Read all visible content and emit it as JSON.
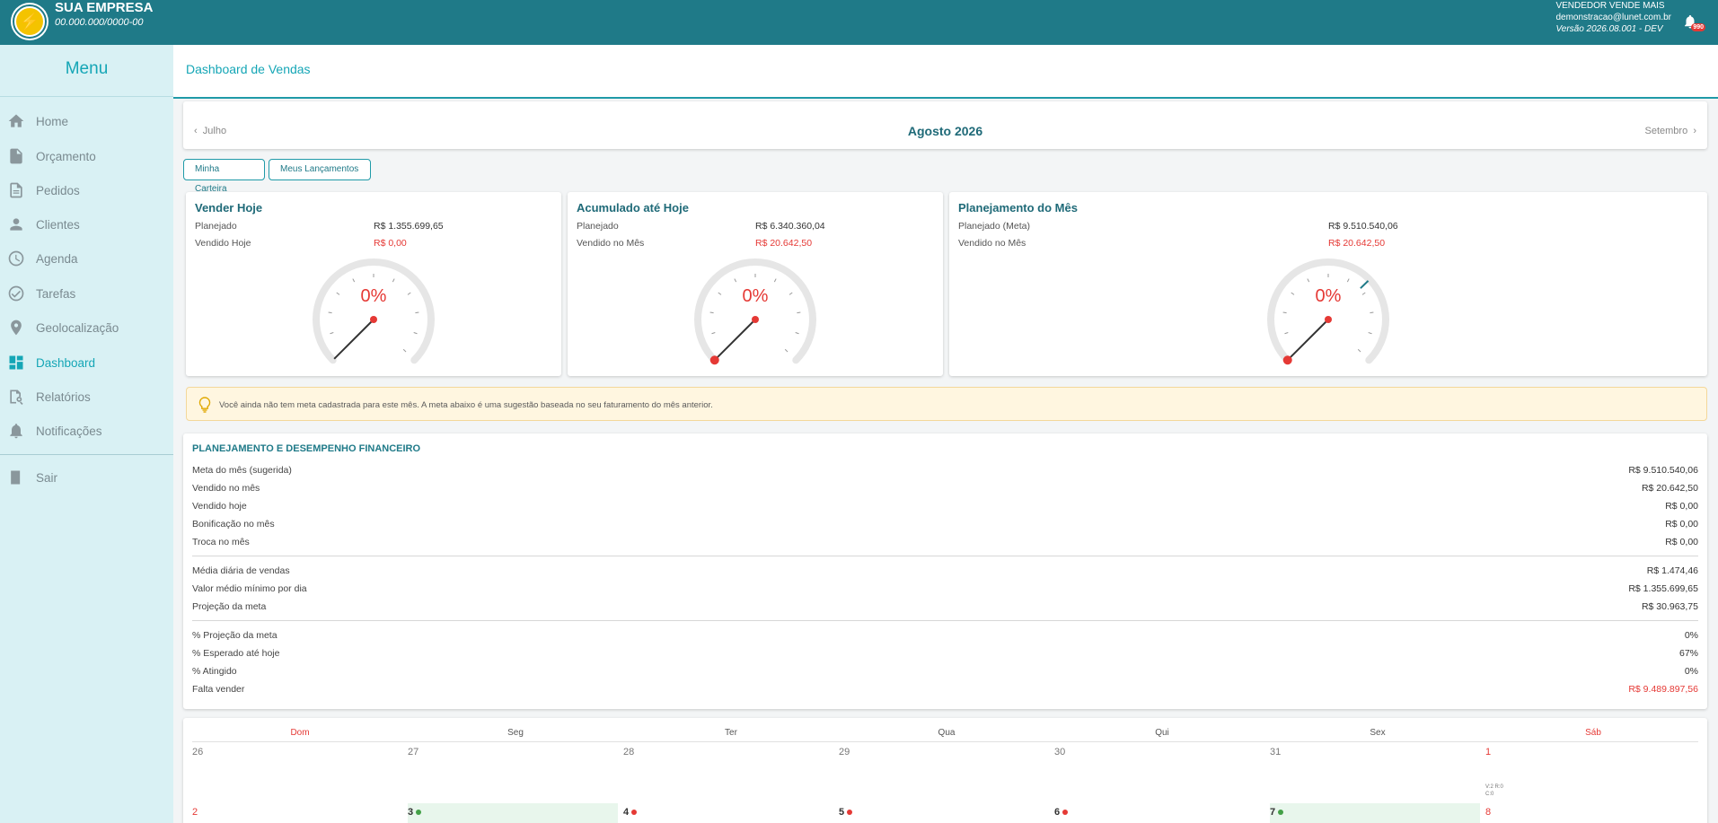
{
  "header": {
    "company_name": "SUA EMPRESA",
    "company_doc": "00.000.000/0000-00",
    "user_name": "VENDEDOR VENDE MAIS",
    "user_email": "demonstracao@lunet.com.br",
    "version": "Versão 2026.08.001 - DEV",
    "notification_count": "990"
  },
  "sidebar": {
    "title": "Menu",
    "items": [
      {
        "label": "Home",
        "icon": "home-icon"
      },
      {
        "label": "Orçamento",
        "icon": "file-icon"
      },
      {
        "label": "Pedidos",
        "icon": "document-icon"
      },
      {
        "label": "Clientes",
        "icon": "person-icon"
      },
      {
        "label": "Agenda",
        "icon": "clock-icon"
      },
      {
        "label": "Tarefas",
        "icon": "check-circle-icon"
      },
      {
        "label": "Geolocalização",
        "icon": "location-pin-icon"
      },
      {
        "label": "Dashboard",
        "icon": "dashboard-icon"
      },
      {
        "label": "Relatórios",
        "icon": "report-search-icon"
      },
      {
        "label": "Notificações",
        "icon": "bell-icon"
      },
      {
        "label": "Sair",
        "icon": "exit-door-icon"
      }
    ],
    "active": "Dashboard"
  },
  "page": {
    "title": "Dashboard de Vendas"
  },
  "month_nav": {
    "prev": "Julho",
    "current": "Agosto 2026",
    "next": "Setembro"
  },
  "buttons": {
    "wallet": "Minha Carteira",
    "entries": "Meus Lançamentos"
  },
  "gauges": [
    {
      "title": "Vender Hoje",
      "row1_label": "Planejado",
      "row1_value": "R$ 1.355.699,65",
      "row2_label": "Vendido Hoje",
      "row2_value": "R$ 0,00",
      "percent_text": "0%",
      "percent": 0
    },
    {
      "title": "Acumulado até Hoje",
      "row1_label": "Planejado",
      "row1_value": "R$ 6.340.360,04",
      "row2_label": "Vendido no Mês",
      "row2_value": "R$ 20.642,50",
      "percent_text": "0%",
      "percent": 0
    },
    {
      "title": "Planejamento do Mês",
      "row1_label": "Planejado (Meta)",
      "row1_value": "R$ 9.510.540,06",
      "row2_label": "Vendido no Mês",
      "row2_value": "R$ 20.642,50",
      "percent_text": "0%",
      "percent": 0
    }
  ],
  "alert": {
    "text": "Você ainda não tem meta cadastrada para este mês. A meta abaixo é uma sugestão baseada no seu faturamento do mês anterior."
  },
  "financial": {
    "title": "PLANEJAMENTO E DESEMPENHO FINANCEIRO",
    "rows": [
      {
        "label": "Meta do mês (sugerida)",
        "value": "R$ 9.510.540,06"
      },
      {
        "label": "Vendido no mês",
        "value": "R$ 20.642,50"
      },
      {
        "label": "Vendido hoje",
        "value": "R$ 0,00"
      },
      {
        "label": "Bonificação no mês",
        "value": "R$ 0,00"
      },
      {
        "label": "Troca no mês",
        "value": "R$ 0,00"
      },
      {
        "label": "Média diária de vendas",
        "value": "R$ 1.474,46"
      },
      {
        "label": "Valor médio mínimo por dia",
        "value": "R$ 1.355.699,65"
      },
      {
        "label": "Projeção da meta",
        "value": "R$ 30.963,75"
      },
      {
        "label": "% Projeção da meta",
        "value": "0%"
      },
      {
        "label": "% Esperado até hoje",
        "value": "67%"
      },
      {
        "label": "% Atingido",
        "value": "0%"
      },
      {
        "label": "Falta vender",
        "value": "R$ 9.489.897,56"
      }
    ]
  },
  "calendar": {
    "weekdays": [
      "Dom",
      "Seg",
      "Ter",
      "Qua",
      "Qui",
      "Sex",
      "Sáb"
    ],
    "week1": [
      "26",
      "27",
      "28",
      "29",
      "30",
      "31",
      "1"
    ],
    "week2": [
      "2",
      "3",
      "4",
      "5",
      "6",
      "7",
      "8"
    ],
    "sat_note_line1": "V:2 R:0",
    "sat_note_line2": "C:0",
    "colors": {
      "green": "#43a047",
      "red": "#e53935"
    }
  }
}
